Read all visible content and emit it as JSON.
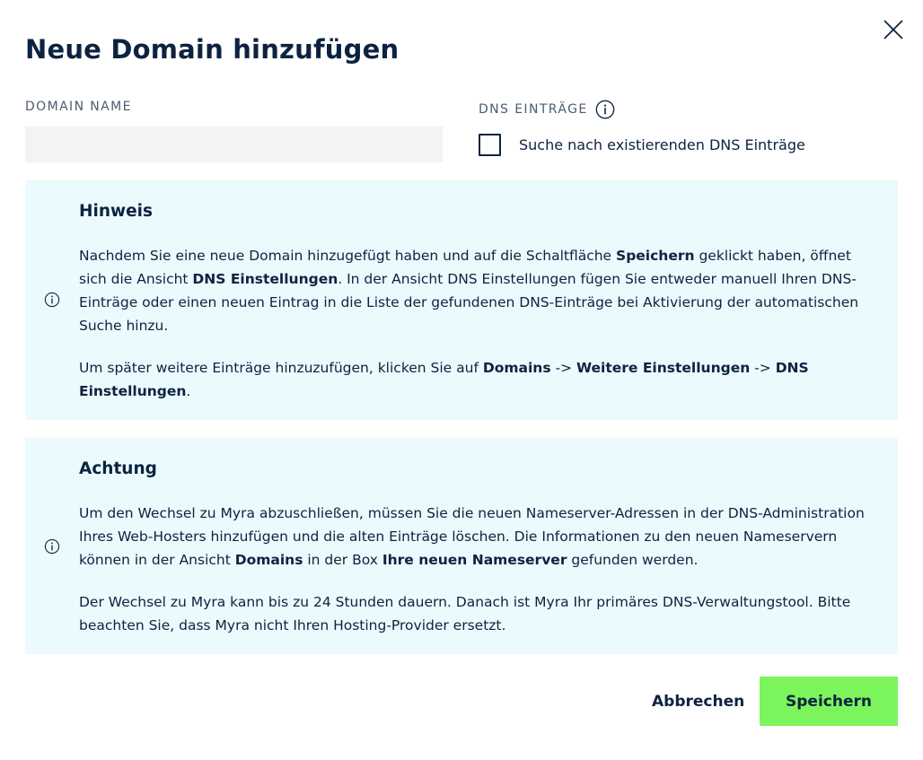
{
  "dialog": {
    "title": "Neue Domain hinzufügen",
    "close_icon": "close-icon"
  },
  "form": {
    "domain_name_label": "DOMAIN NAME",
    "domain_name_value": "",
    "dns_entries_label": "DNS EINTRÄGE",
    "dns_info_icon": "info-icon",
    "search_checkbox_label": "Suche nach existierenden DNS Einträge",
    "search_checkbox_checked": false
  },
  "hint": {
    "title": "Hinweis",
    "icon": "info-icon",
    "p1_a": "Nachdem Sie eine neue Domain hinzugefügt haben und auf die Schaltfläche ",
    "p1_b": "Speichern",
    "p1_c": " geklickt haben, öffnet sich die Ansicht ",
    "p1_d": "DNS Einstellungen",
    "p1_e": ". In der Ansicht DNS Einstellungen fügen Sie entweder manuell Ihren DNS-Einträge oder einen neuen Eintrag in die Liste der gefundenen DNS-Einträge bei Aktivierung der automatischen Suche hinzu.",
    "p2_a": "Um später weitere Einträge hinzuzufügen, klicken Sie auf ",
    "p2_b": "Domains",
    "p2_c": " -> ",
    "p2_d": "Weitere Einstellungen",
    "p2_e": " -> ",
    "p2_f": "DNS Einstellungen",
    "p2_g": "."
  },
  "warning": {
    "title": "Achtung",
    "icon": "info-icon",
    "p1_a": "Um den Wechsel zu Myra abzuschließen, müssen Sie die neuen Nameserver-Adressen in der DNS-Administration Ihres Web-Hosters hinzufügen und die alten Einträge löschen. Die Informationen zu den neuen Nameservern können in der Ansicht ",
    "p1_b": "Domains",
    "p1_c": " in der Box ",
    "p1_d": "Ihre neuen Nameserver",
    "p1_e": " gefunden werden.",
    "p2": "Der Wechsel zu Myra kann bis zu 24 Stunden dauern. Danach ist Myra Ihr primäres DNS-Verwaltungstool. Bitte beachten Sie, dass Myra nicht Ihren Hosting-Provider ersetzt."
  },
  "actions": {
    "cancel_label": "Abbrechen",
    "save_label": "Speichern"
  },
  "colors": {
    "text": "#0c2340",
    "notice_bg": "#ebfafd",
    "input_bg": "#f2f3f4",
    "save_bg": "#7cf55c"
  }
}
